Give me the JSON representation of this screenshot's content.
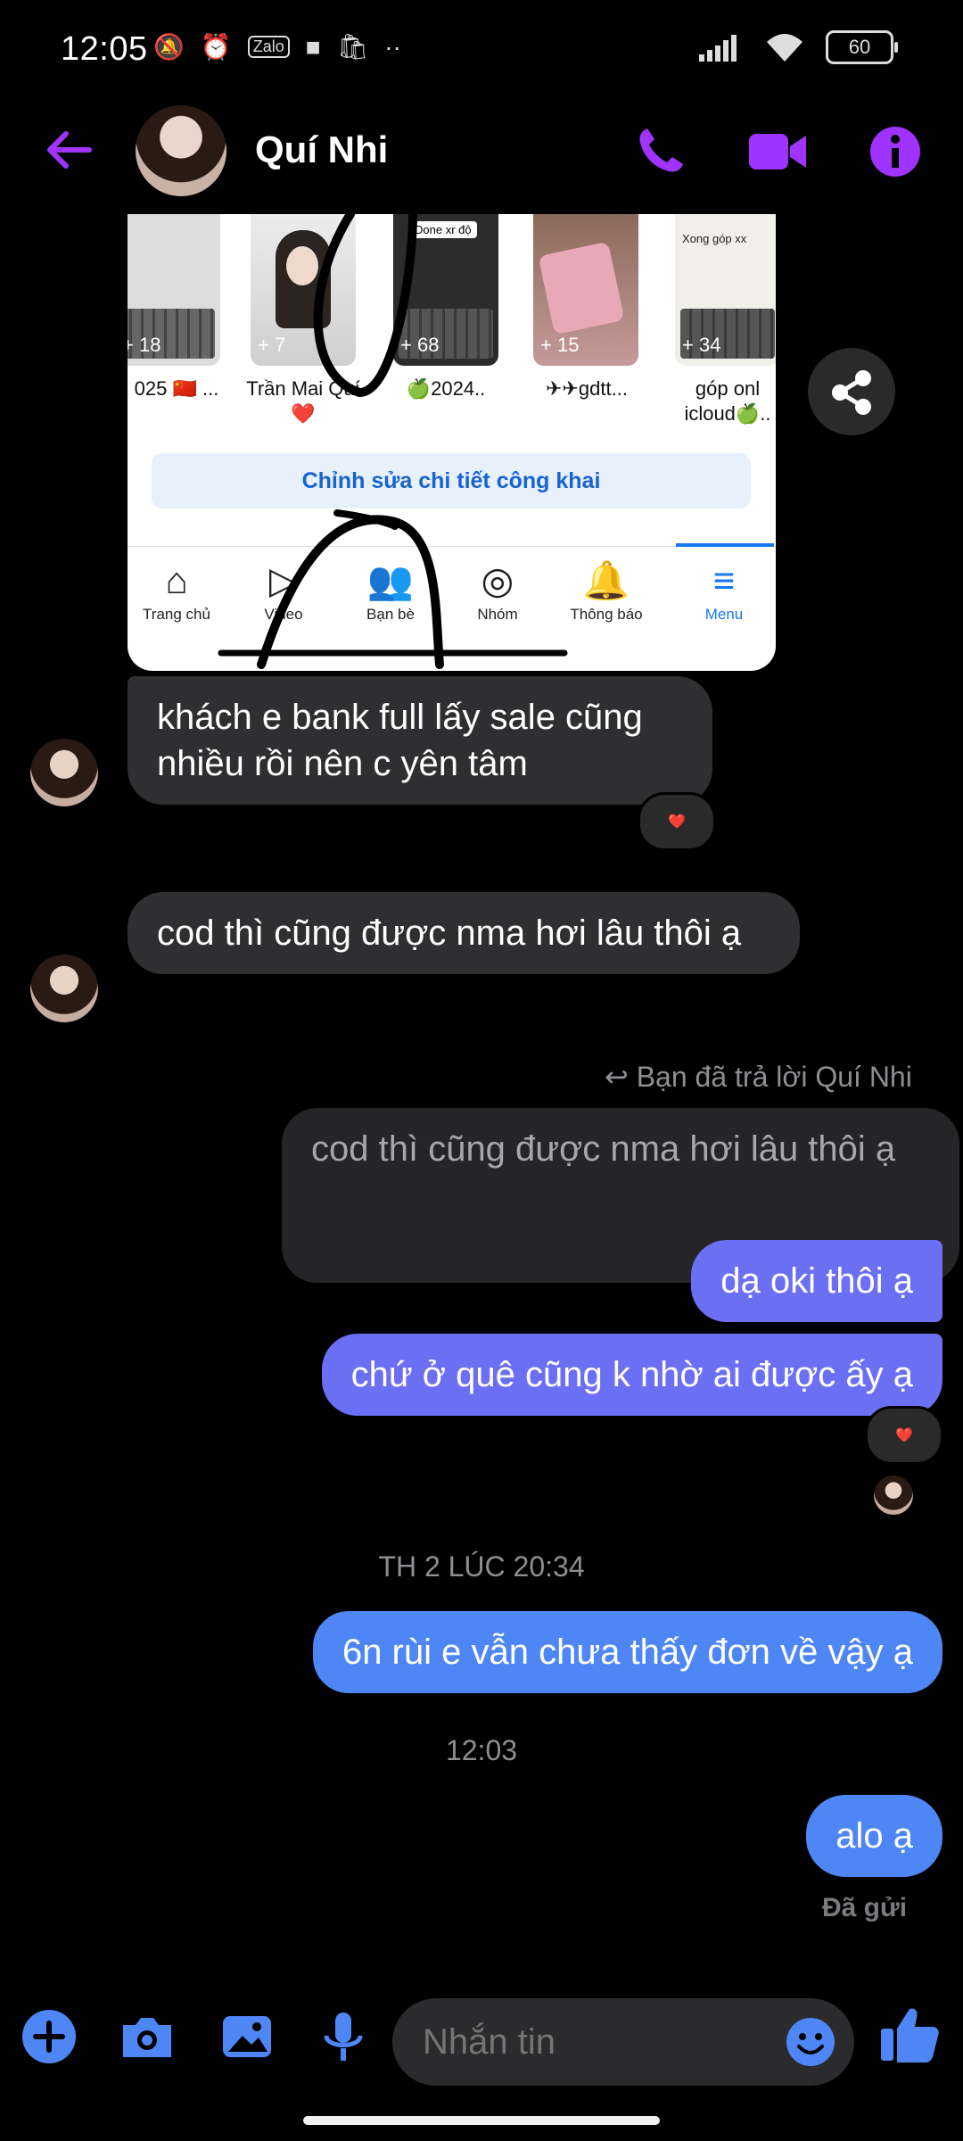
{
  "status_bar": {
    "time": "12:05",
    "battery": "60"
  },
  "header": {
    "contact_name": "Quí Nhi"
  },
  "shared_card": {
    "thumbs": [
      {
        "count": "+ 18",
        "label": "025 🇨🇳 ..."
      },
      {
        "count": "+ 7",
        "label": "Trần Mai Quí❤️"
      },
      {
        "count": "+ 68",
        "label": "🍏2024.."
      },
      {
        "count": "+ 15",
        "label": "✈✈gdtt..."
      },
      {
        "count": "+ 34",
        "label": "góp onl icloud🍏.."
      }
    ],
    "thumb_caption_3": "Done xr độ",
    "thumb_caption_5": "Xong góp xx",
    "edit_public": "Chỉnh sửa chi tiết công khai",
    "tabs": [
      {
        "label": "Trang chủ",
        "icon": "home-icon"
      },
      {
        "label": "Video",
        "icon": "video-icon"
      },
      {
        "label": "Bạn bè",
        "icon": "friends-icon"
      },
      {
        "label": "Nhóm",
        "icon": "groups-icon"
      },
      {
        "label": "Thông báo",
        "icon": "bell-icon"
      },
      {
        "label": "Menu",
        "icon": "menu-icon"
      }
    ]
  },
  "messages": {
    "m1": "khách e bank full lấy sale cũng nhiều rồi nên c yên tâm",
    "m2": "cod thì cũng được nma hơi lâu thôi ạ",
    "reply_meta": "Bạn đã trả lời Quí Nhi",
    "quoted": "cod thì cũng được nma hơi lâu thôi ạ",
    "m3": "dạ oki thôi ạ",
    "m4": "chứ ở quê cũng k nhờ ai được ấy ạ",
    "time1": "TH 2 LÚC 20:34",
    "m5": "6n rùi e vẫn chưa thấy đơn về vậy ạ",
    "time2": "12:03",
    "m6": "alo ạ",
    "sent_status": "Đã gửi"
  },
  "reactions": {
    "r1": "❤️",
    "r2": "❤️"
  },
  "composer": {
    "placeholder": "Nhắn tin"
  },
  "colors": {
    "accent": "#a033ff",
    "outgoing": "#6b6ff4",
    "outgoing_blue": "#4e86f5",
    "incoming": "#2f2f31"
  }
}
